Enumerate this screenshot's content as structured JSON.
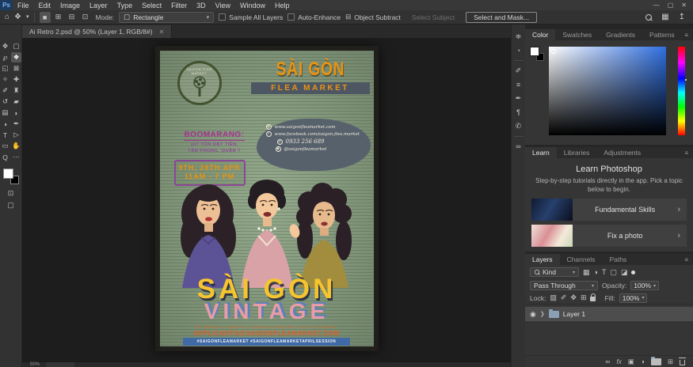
{
  "menubar": {
    "logo": "Ps",
    "items": [
      "File",
      "Edit",
      "Image",
      "Layer",
      "Type",
      "Select",
      "Filter",
      "3D",
      "View",
      "Window",
      "Help"
    ],
    "window_controls": {
      "minimize": "—",
      "maximize": "▢",
      "close": "✕"
    }
  },
  "options_bar": {
    "home_icon": "⌂",
    "active_tool_icon": "❖",
    "caret": "▾",
    "selection_modes": [
      {
        "name": "new-selection",
        "glyph": "■"
      },
      {
        "name": "add-to-selection",
        "glyph": "⊞"
      },
      {
        "name": "subtract-from-selection",
        "glyph": "⊟"
      },
      {
        "name": "intersect-selection",
        "glyph": "⊡"
      }
    ],
    "mode_label": "Mode:",
    "mode_icon": "▢",
    "mode_value": "Rectangle",
    "sample_all_layers": "Sample All Layers",
    "auto_enhance": "Auto-Enhance",
    "object_subtract_icon": "⊟",
    "object_subtract": "Object Subtract",
    "select_subject": "Select Subject",
    "select_and_mask": "Select and Mask...",
    "layout_icon": "▦",
    "share_icon": "↥"
  },
  "document": {
    "tab_title": "Ai Retro 2.psd @ 50% (Layer 1, RGB/8#)",
    "tab_close": "✕",
    "zoom_level": "50%"
  },
  "toolbar": {
    "tools": [
      {
        "name": "move-tool",
        "glyph": "✥"
      },
      {
        "name": "marquee-tool",
        "glyph": "▢"
      },
      {
        "name": "lasso-tool",
        "glyph": "℘"
      },
      {
        "name": "object-selection-tool",
        "glyph": "❖"
      },
      {
        "name": "crop-tool",
        "glyph": "◱"
      },
      {
        "name": "frame-tool",
        "glyph": "⊠"
      },
      {
        "name": "eyedropper-tool",
        "glyph": "✧"
      },
      {
        "name": "healing-brush-tool",
        "glyph": "✚"
      },
      {
        "name": "brush-tool",
        "glyph": "✐"
      },
      {
        "name": "clone-stamp-tool",
        "glyph": "♜"
      },
      {
        "name": "history-brush-tool",
        "glyph": "↺"
      },
      {
        "name": "eraser-tool",
        "glyph": "▰"
      },
      {
        "name": "gradient-tool",
        "glyph": "▤"
      },
      {
        "name": "blur-tool",
        "glyph": "◗"
      },
      {
        "name": "dodge-tool",
        "glyph": "◑"
      },
      {
        "name": "pen-tool",
        "glyph": "✒"
      },
      {
        "name": "type-tool",
        "glyph": "T"
      },
      {
        "name": "path-selection-tool",
        "glyph": "▷"
      },
      {
        "name": "rectangle-tool",
        "glyph": "▭"
      },
      {
        "name": "hand-tool",
        "glyph": "✋"
      },
      {
        "name": "zoom-tool",
        "glyph": "Q"
      },
      {
        "name": "edit-toolbar",
        "glyph": "⋯"
      }
    ],
    "bottom_icons": [
      {
        "name": "quick-mask-icon",
        "glyph": "⊡"
      },
      {
        "name": "screen-mode-icon",
        "glyph": "▢"
      }
    ]
  },
  "dock_icons": [
    {
      "name": "properties-panel-icon",
      "glyph": "≑"
    },
    {
      "name": "history-panel-icon",
      "glyph": "◔"
    },
    {
      "name": "brushes-panel-icon",
      "glyph": "✐"
    },
    {
      "name": "adjustments-panel-icon",
      "glyph": "≡"
    },
    {
      "name": "paths-panel-icon",
      "glyph": "✒"
    },
    {
      "name": "paragraph-panel-icon",
      "glyph": "¶"
    },
    {
      "name": "comments-panel-icon",
      "glyph": "✆"
    },
    {
      "name": "libraries-panel-icon",
      "glyph": "∞"
    }
  ],
  "panels": {
    "color": {
      "tabs": [
        "Color",
        "Swatches",
        "Gradients",
        "Patterns"
      ],
      "menu_icon": "≡"
    },
    "learn": {
      "tabs": [
        "Learn",
        "Libraries",
        "Adjustments"
      ],
      "menu_icon": "≡",
      "title": "Learn Photoshop",
      "subtitle": "Step-by-step tutorials directly in the app. Pick a topic below to begin.",
      "items": [
        {
          "label": "Fundamental Skills",
          "chevron": "›"
        },
        {
          "label": "Fix a photo",
          "chevron": "›"
        }
      ]
    },
    "layers": {
      "tabs": [
        "Layers",
        "Channels",
        "Paths"
      ],
      "menu_icon": "≡",
      "filter_label": "Kind",
      "filter_caret": "▾",
      "filter_icons": [
        {
          "name": "filter-pixel-icon",
          "glyph": "▦"
        },
        {
          "name": "filter-adjustment-icon",
          "glyph": "◑"
        },
        {
          "name": "filter-type-icon",
          "glyph": "T"
        },
        {
          "name": "filter-shape-icon",
          "glyph": "▢"
        },
        {
          "name": "filter-smart-object-icon",
          "glyph": "◪"
        }
      ],
      "blend_mode": "Pass Through",
      "opacity_label": "Opacity:",
      "opacity_value": "100%",
      "lock_label": "Lock:",
      "lock_icons": [
        {
          "name": "lock-transparency-icon",
          "glyph": "▨"
        },
        {
          "name": "lock-pixels-icon",
          "glyph": "✐"
        },
        {
          "name": "lock-position-icon",
          "glyph": "✥"
        },
        {
          "name": "lock-artboard-icon",
          "glyph": "⊞"
        }
      ],
      "fill_label": "Fill:",
      "fill_value": "100%",
      "layer_rows": [
        {
          "eye": "◉",
          "expander": "❯",
          "name": "Layer 1"
        }
      ],
      "bottom_icons": {
        "link": "∞",
        "fx": "fx",
        "mask": "▣",
        "adjustment": "◑",
        "new_layer": "⊞"
      }
    }
  },
  "poster": {
    "logo_text": "SAIGON FLEA MARKET",
    "title_line1": "SÀI GÒN",
    "title_line2": "FLEA MARKET",
    "contact": {
      "website_icon": "⊕",
      "website": "www.saigonfleamarket.com",
      "facebook_icon": "f",
      "facebook": "www.facebook.com/saigon.flea.market",
      "phone_icon": "✆",
      "phone": "0933 256 689",
      "instagram_icon": "◉",
      "instagram": "@saigonfleamarket"
    },
    "venue_name": "BOOMARANG:",
    "venue_line1": "107 TÔN DẬT TIÊN,",
    "venue_line2": "TÂN PHONG, QUẬN 7",
    "date_line1": "9TH, 28TH APR",
    "date_line2": "11AM - 7 PM",
    "headline1": "SÀI GÒN",
    "headline2": "VINTAGE",
    "note_line": "TO BOOK A BOOTH, PLEASE CONTACT US VIA EMAIL",
    "email": "APPLICANTS@SAIGONFLEAMARKET.COM",
    "hashtags": "#SAIGONFLEAMARKET  #SAIGONFLEAMARKETAPRILSESSION"
  },
  "colors": {
    "poster_green": "#8da287",
    "poster_orange": "#ea9312",
    "poster_yellow": "#f6c42e",
    "poster_pink": "#e79ca6",
    "poster_blue_band": "#3f6aa6",
    "poster_magenta": "#a5338f",
    "ui_dark": "#323232",
    "canvas_dark": "#1d1d1d"
  }
}
